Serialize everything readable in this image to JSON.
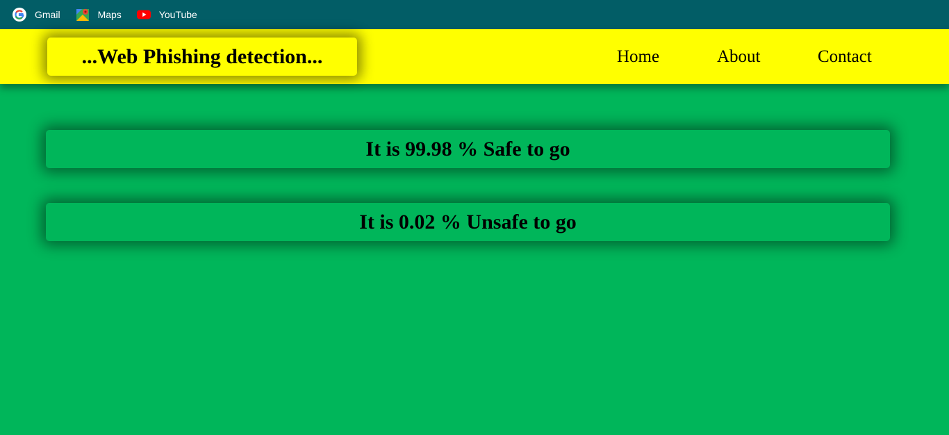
{
  "bookmarks": [
    {
      "label": "Gmail",
      "icon": "google-icon"
    },
    {
      "label": "Maps",
      "icon": "maps-icon"
    },
    {
      "label": "YouTube",
      "icon": "youtube-icon"
    }
  ],
  "navbar": {
    "brand": "...Web Phishing detection...",
    "links": [
      "Home",
      "About",
      "Contact"
    ]
  },
  "results": {
    "safe_text": "It is 99.98 % Safe to go",
    "unsafe_text": "It is 0.02 % Unsafe to go"
  },
  "colors": {
    "bookmarks_bar": "#025d66",
    "navbar": "#ffff00",
    "page_background": "#00b65a"
  }
}
